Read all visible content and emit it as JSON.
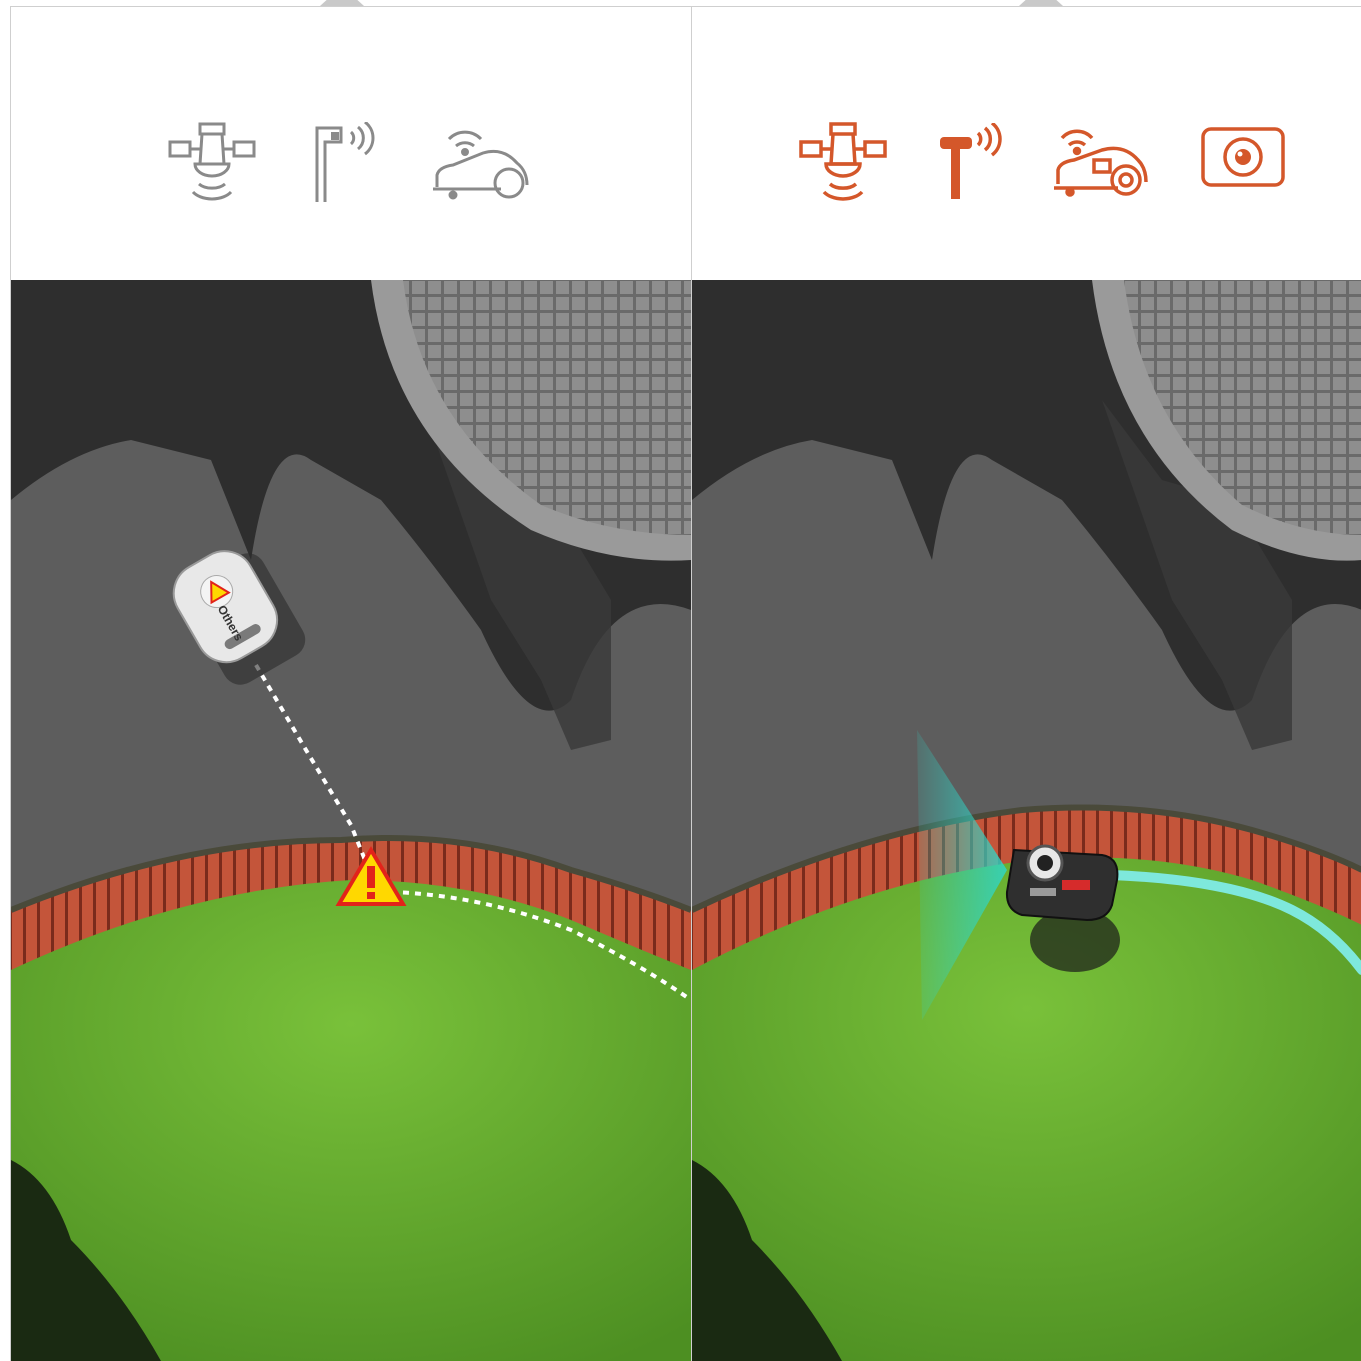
{
  "comparison": {
    "left_panel": {
      "icons": [
        "satellite-icon",
        "rtk-antenna-icon",
        "mower-icon"
      ],
      "icon_color": "#8a8a8a",
      "mower_label": "Others",
      "warning_color": "#ffd800",
      "path_color": "#ffffff"
    },
    "right_panel": {
      "icons": [
        "satellite-icon",
        "rtk-station-icon",
        "mower-icon",
        "camera-icon"
      ],
      "icon_color": "#d4572a",
      "vision_color": "#2fd6c8",
      "path_color": "#7ee8dc"
    }
  },
  "colors": {
    "asphalt": "#5b5b5b",
    "shadow": "#2b2b2b",
    "brick": "#b34a33",
    "grass": "#5fa62b",
    "divider": "#cfcfcf"
  }
}
